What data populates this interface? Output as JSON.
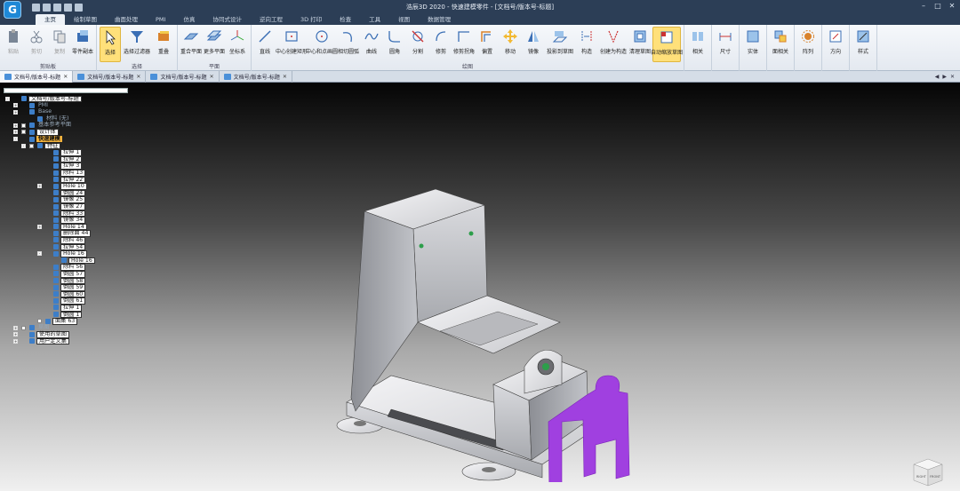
{
  "window": {
    "logo_letter": "G",
    "title": "浩辰3D 2020 - 快速建模零件 - [文档号/版本号-标题]"
  },
  "tabs": [
    "主页",
    "绘制草图",
    "曲面处理",
    "PMI",
    "仿真",
    "协同式设计",
    "逆向工程",
    "3D 打印",
    "检查",
    "工具",
    "视图",
    "数据管理"
  ],
  "active_tab_index": 0,
  "ribbon": {
    "groups": [
      {
        "label": "剪贴板",
        "buttons": [
          {
            "label": "粘贴",
            "icon": "paste-icon",
            "disabled": true
          },
          {
            "label": "剪切",
            "icon": "cut-icon",
            "disabled": true
          },
          {
            "label": "复制",
            "icon": "copy-icon",
            "disabled": true
          },
          {
            "label": "零件副本",
            "icon": "part-copy-icon",
            "disabled": false
          }
        ]
      },
      {
        "label": "选择",
        "buttons": [
          {
            "label": "选择",
            "icon": "select-arrow-icon",
            "selected": true
          },
          {
            "label": "选择过滤器",
            "icon": "filter-icon"
          },
          {
            "label": "重叠",
            "icon": "overlap-icon"
          }
        ]
      },
      {
        "label": "平面",
        "buttons": [
          {
            "label": "重合平面",
            "icon": "coincident-plane-icon"
          },
          {
            "label": "更多平面",
            "icon": "more-planes-icon"
          },
          {
            "label": "坐标系",
            "icon": "coordinate-system-icon"
          }
        ]
      },
      {
        "label": "绘图",
        "buttons": [
          {
            "label": "直线",
            "icon": "line-icon"
          },
          {
            "label": "中心创建矩形",
            "icon": "center-rectangle-icon"
          },
          {
            "label": "中心和点画圆",
            "icon": "center-circle-icon"
          },
          {
            "label": "相切圆弧",
            "icon": "tangent-arc-icon"
          },
          {
            "label": "曲线",
            "icon": "curve-icon"
          },
          {
            "label": "圆角",
            "icon": "fillet-icon"
          },
          {
            "label": "分割",
            "icon": "split-icon"
          },
          {
            "label": "修剪",
            "icon": "trim-icon"
          },
          {
            "label": "修剪拐角",
            "icon": "trim-corner-icon"
          },
          {
            "label": "偏置",
            "icon": "offset-icon"
          },
          {
            "label": "移动",
            "icon": "move-icon"
          },
          {
            "label": "镜像",
            "icon": "mirror-icon"
          },
          {
            "label": "投影到草图",
            "icon": "project-to-sketch-icon"
          },
          {
            "label": "构造",
            "icon": "construct-icon"
          },
          {
            "label": "创建为构造",
            "icon": "create-construction-icon"
          },
          {
            "label": "清理草图",
            "icon": "clean-sketch-icon"
          },
          {
            "label": "自动缩放草图",
            "icon": "auto-scale-sketch-icon",
            "selected": true
          }
        ]
      },
      {
        "label": "",
        "buttons": [
          {
            "label": "相关",
            "icon": "relate-icon"
          }
        ]
      },
      {
        "label": "",
        "buttons": [
          {
            "label": "尺寸",
            "icon": "dimension-icon"
          }
        ]
      },
      {
        "label": "",
        "buttons": [
          {
            "label": "实体",
            "icon": "solid-icon"
          }
        ]
      },
      {
        "label": "",
        "buttons": [
          {
            "label": "面相关",
            "icon": "face-relate-icon"
          }
        ]
      },
      {
        "label": "",
        "buttons": [
          {
            "label": "阵列",
            "icon": "pattern-icon"
          }
        ]
      },
      {
        "label": "",
        "buttons": [
          {
            "label": "方向",
            "icon": "orientation-icon"
          }
        ]
      },
      {
        "label": "",
        "buttons": [
          {
            "label": "样式",
            "icon": "style-icon"
          }
        ]
      }
    ]
  },
  "doc_tabs": [
    "文档号/版本号-标题",
    "文档号/版本号-标题",
    "文档号/版本号-标题",
    "文档号/版本号-标题"
  ],
  "tree": [
    {
      "label": "文档号/版本号-标题",
      "indent": 0,
      "exp": "-",
      "check": false,
      "box": true
    },
    {
      "label": "PMI",
      "indent": 1,
      "exp": "+",
      "dim": true
    },
    {
      "label": "Base",
      "indent": 1,
      "exp": "+",
      "dim": true
    },
    {
      "label": "材料 (无)",
      "indent": 2,
      "dim": true
    },
    {
      "label": "基本参考平面",
      "indent": 1,
      "exp": "+",
      "check": true,
      "dim": true
    },
    {
      "label": "设计体",
      "indent": 1,
      "exp": "+",
      "check": true,
      "box": true
    },
    {
      "label": "快速建模",
      "indent": 1,
      "exp": "-",
      "highlight": true
    },
    {
      "label": "特征",
      "indent": 2,
      "exp": "-",
      "check": true,
      "box": true
    },
    {
      "label": "拉伸 1",
      "indent": 4,
      "box": true
    },
    {
      "label": "拉伸 2",
      "indent": 4,
      "box": true
    },
    {
      "label": "拉伸 3",
      "indent": 4,
      "box": true
    },
    {
      "label": "除料 13",
      "indent": 4,
      "box": true
    },
    {
      "label": "拉伸 22",
      "indent": 4,
      "box": true
    },
    {
      "label": "Hole 10",
      "indent": 4,
      "exp": "+",
      "box": true
    },
    {
      "label": "倒圆 24",
      "indent": 4,
      "box": true
    },
    {
      "label": "镜像 25",
      "indent": 4,
      "box": true
    },
    {
      "label": "镜像 27",
      "indent": 4,
      "box": true
    },
    {
      "label": "除料 33",
      "indent": 4,
      "box": true
    },
    {
      "label": "镜像 34",
      "indent": 4,
      "box": true
    },
    {
      "label": "Hole 14",
      "indent": 4,
      "exp": "+",
      "box": true
    },
    {
      "label": "删除面 44",
      "indent": 4,
      "box": true
    },
    {
      "label": "除料 46",
      "indent": 4,
      "box": true
    },
    {
      "label": "拉伸 54",
      "indent": 4,
      "box": true
    },
    {
      "label": "Hole 16",
      "indent": 4,
      "exp": "-",
      "box": true
    },
    {
      "label": "Hole 16",
      "indent": 5,
      "box": true
    },
    {
      "label": "除料 56",
      "indent": 4,
      "box": true
    },
    {
      "label": "倒圆 57",
      "indent": 4,
      "box": true
    },
    {
      "label": "倒圆 58",
      "indent": 4,
      "box": true
    },
    {
      "label": "倒圆 59",
      "indent": 4,
      "box": true
    },
    {
      "label": "倒圆 60",
      "indent": 4,
      "box": true
    },
    {
      "label": "倒圆 61",
      "indent": 4,
      "box": true
    },
    {
      "label": "拉伸 1",
      "indent": 4,
      "box": true
    },
    {
      "label": "倒圆 1",
      "indent": 4,
      "box": true
    },
    {
      "label": "面集 63",
      "indent": 3,
      "check": true,
      "box": true
    },
    {
      "label": "草图",
      "indent": 1,
      "exp": "+",
      "check": true,
      "dim": true
    },
    {
      "label": "使用的草图",
      "indent": 1,
      "exp": "+",
      "box": true
    },
    {
      "label": "用户定义集",
      "indent": 1,
      "exp": "+",
      "box": true
    }
  ],
  "viewcube": {
    "left_label": "RIGHT",
    "front_label": "FRONT"
  },
  "colors": {
    "accent": "#2c3e56",
    "profile": "#a040e0",
    "highlight": "#f3b33d"
  }
}
